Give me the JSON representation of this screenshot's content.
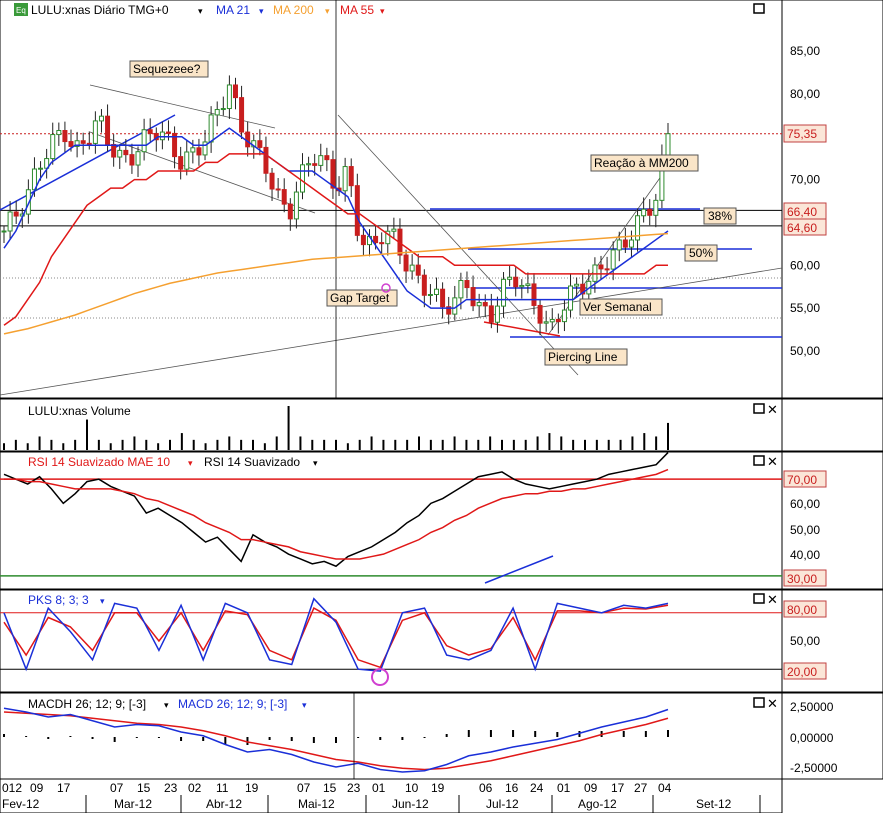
{
  "header": {
    "icon_label": "Eq",
    "symbol": "LULU:xnas Diário TMG+0",
    "ma21": "MA 21",
    "ma200": "MA 200",
    "ma55": "MA 55"
  },
  "colors": {
    "up": "#2e8b2e",
    "down": "#c81e1e",
    "ma21": "#1a2fd8",
    "ma55": "#e01818",
    "ma200": "#f5a030",
    "rsi": "#000000",
    "rsi_mae": "#e01818",
    "pks_k": "#1a2fd8",
    "pks_d": "#e01818",
    "macd": "#1a2fd8",
    "macd_signal": "#e01818"
  },
  "annotations": {
    "squeeze": "Sequezeee?",
    "gap_target": "Gap Target",
    "reacao": "Reação à MM200",
    "ver_semanal": "Ver Semanal",
    "piercing": "Piercing Line",
    "fib38": "38%",
    "fib50": "50%"
  },
  "price_axis": {
    "ticks": [
      "85,00",
      "80,00",
      "75,00",
      "70,00",
      "65,00",
      "60,00",
      "55,00",
      "50,00"
    ],
    "last_price": "75,35",
    "level_6640": "66,40",
    "level_6460": "64,60"
  },
  "volume_panel": {
    "title": "LULU:xnas Volume"
  },
  "rsi_panel": {
    "title_a": "RSI 14 Suavizado MAE 10",
    "title_b": "RSI 14 Suavizado",
    "ticks": [
      "60,00",
      "50,00",
      "40,00"
    ],
    "upper": "70,00",
    "lower": "30,00"
  },
  "pks_panel": {
    "title": "PKS 8; 3; 3",
    "upper": "80,00",
    "mid": "50,00",
    "lower": "20,00"
  },
  "macd_panel": {
    "title_a": "MACDH 26; 12; 9; [-3]",
    "title_b": "MACD 26; 12; 9; [-3]",
    "ticks": [
      "2,50000",
      "0,00000",
      "-2,50000"
    ]
  },
  "time_axis": {
    "days": [
      "012",
      "09",
      "17",
      "07",
      "15",
      "23",
      "02",
      "11",
      "19",
      "07",
      "15",
      "23",
      "01",
      "10",
      "19",
      "06",
      "16",
      "24",
      "01",
      "09",
      "17",
      "27",
      "04"
    ],
    "months": [
      "Fev-12",
      "Mar-12",
      "Abr-12",
      "Mai-12",
      "Jun-12",
      "Jul-12",
      "Ago-12",
      "Set-12"
    ]
  },
  "chart_data": {
    "type": "candlestick",
    "title": "LULU:xnas Diário TMG+0",
    "ylim": [
      45,
      88
    ],
    "price_levels": [
      75.35,
      66.4,
      64.6
    ],
    "ohlc_path": [
      64,
      66,
      68,
      72,
      74,
      76,
      73,
      75,
      77,
      74,
      72,
      73,
      75,
      76,
      74,
      72,
      73,
      75,
      78,
      81,
      76,
      74,
      72,
      68,
      66,
      70,
      73,
      72,
      69,
      71,
      63,
      62,
      64,
      63,
      60,
      58,
      57,
      55,
      56,
      58,
      55,
      54,
      57,
      59,
      57,
      55,
      52,
      55,
      57,
      58,
      59,
      61,
      62,
      64,
      66,
      68,
      75.35
    ],
    "series": [
      {
        "name": "MA 21",
        "values": [
          62,
          64,
          67,
          70,
          72,
          73,
          74,
          74,
          74,
          74,
          74,
          74,
          74,
          75,
          75,
          75,
          74,
          74,
          75,
          76,
          75,
          74,
          73,
          72,
          71,
          71,
          71,
          70,
          69,
          68,
          65,
          63,
          61,
          59,
          57,
          56,
          55,
          55,
          55,
          56,
          56,
          56,
          56,
          56,
          56,
          56,
          56,
          56,
          56,
          57,
          58,
          59,
          60,
          61,
          62,
          63,
          64
        ]
      },
      {
        "name": "MA 55",
        "values": [
          53,
          54,
          56,
          58,
          61,
          63,
          65,
          67,
          68,
          69,
          69,
          70,
          70,
          71,
          71,
          71,
          71,
          72,
          72,
          73,
          73,
          73,
          73,
          72,
          71,
          70,
          69,
          68,
          67,
          66,
          66,
          65,
          64,
          63,
          62,
          61,
          61,
          61,
          60,
          60,
          60,
          60,
          60,
          60,
          59,
          59,
          59,
          59,
          59,
          59,
          59,
          59,
          59,
          59,
          59,
          60,
          60
        ]
      },
      {
        "name": "MA 200",
        "values": [
          52,
          52.3,
          52.6,
          53,
          53.4,
          53.8,
          54.2,
          54.7,
          55.2,
          55.7,
          56.2,
          56.7,
          57.1,
          57.5,
          57.9,
          58.2,
          58.5,
          58.8,
          59.1,
          59.3,
          59.5,
          59.7,
          59.9,
          60.1,
          60.3,
          60.5,
          60.7,
          60.8,
          60.9,
          61,
          61.1,
          61.2,
          61.3,
          61.4,
          61.5,
          61.6,
          61.7,
          61.8,
          61.9,
          62,
          62.1,
          62.2,
          62.3,
          62.4,
          62.5,
          62.6,
          62.7,
          62.8,
          62.9,
          63,
          63.1,
          63.2,
          63.3,
          63.4,
          63.5,
          63.6,
          63.7
        ]
      }
    ],
    "rsi": [
      72,
      70,
      68,
      71,
      66,
      60,
      64,
      69,
      70,
      67,
      65,
      63,
      56,
      58,
      55,
      52,
      48,
      44,
      46,
      41,
      36,
      47,
      44,
      42,
      39,
      37,
      35,
      36,
      34,
      38,
      40,
      42,
      45,
      48,
      52,
      55,
      60,
      62,
      65,
      68,
      71,
      72,
      73,
      70,
      68,
      67,
      66,
      67,
      68,
      69,
      70,
      72,
      73,
      74,
      75,
      76,
      81
    ],
    "rsi_mae": [
      70,
      70,
      69,
      69,
      68,
      67,
      66,
      66,
      66,
      66,
      65,
      64,
      62,
      61,
      59,
      57,
      55,
      52,
      50,
      48,
      45,
      45,
      44,
      43,
      42,
      40,
      39,
      38,
      37,
      37,
      37,
      38,
      39,
      41,
      43,
      45,
      48,
      50,
      53,
      55,
      58,
      60,
      62,
      63,
      64,
      64,
      65,
      65,
      66,
      66,
      67,
      68,
      69,
      70,
      71,
      72,
      74
    ],
    "pks_k": [
      80,
      20,
      85,
      60,
      30,
      90,
      85,
      40,
      88,
      30,
      90,
      80,
      30,
      25,
      95,
      70,
      20,
      18,
      80,
      85,
      35,
      30,
      40,
      85,
      20,
      90,
      85,
      80,
      88,
      85,
      90
    ],
    "pks_d": [
      70,
      35,
      75,
      65,
      40,
      80,
      80,
      50,
      80,
      40,
      82,
      78,
      40,
      30,
      85,
      72,
      30,
      22,
      72,
      80,
      45,
      35,
      42,
      75,
      30,
      82,
      82,
      80,
      85,
      84,
      88
    ],
    "macd": [
      2.3,
      2.0,
      1.6,
      1.8,
      1.3,
      0.8,
      1.0,
      0.9,
      0.4,
      0.1,
      -0.6,
      -1.2,
      -1.0,
      -1.4,
      -2.0,
      -2.4,
      -2.1,
      -2.6,
      -2.8,
      -2.7,
      -2.2,
      -1.5,
      -1.2,
      -0.8,
      -0.5,
      -0.2,
      0.3,
      0.8,
      1.2,
      1.6,
      2.2
    ],
    "macd_signal": [
      2.0,
      1.9,
      1.8,
      1.7,
      1.5,
      1.3,
      1.1,
      1.0,
      0.8,
      0.5,
      0.1,
      -0.4,
      -0.7,
      -1.0,
      -1.4,
      -1.8,
      -2.0,
      -2.3,
      -2.5,
      -2.6,
      -2.5,
      -2.2,
      -1.9,
      -1.5,
      -1.1,
      -0.7,
      -0.3,
      0.2,
      0.6,
      1.0,
      1.5
    ],
    "volume": [
      2,
      3,
      2,
      4,
      3,
      2,
      3,
      9,
      3,
      2,
      3,
      4,
      3,
      2,
      3,
      5,
      3,
      2,
      3,
      4,
      3,
      3,
      2,
      4,
      13,
      4,
      3,
      3,
      3,
      2,
      3,
      4,
      3,
      3,
      3,
      4,
      3,
      3,
      4,
      3,
      3,
      4,
      3,
      3,
      3,
      4,
      5,
      4,
      3,
      3,
      3,
      3,
      3,
      4,
      5,
      4,
      8
    ]
  }
}
